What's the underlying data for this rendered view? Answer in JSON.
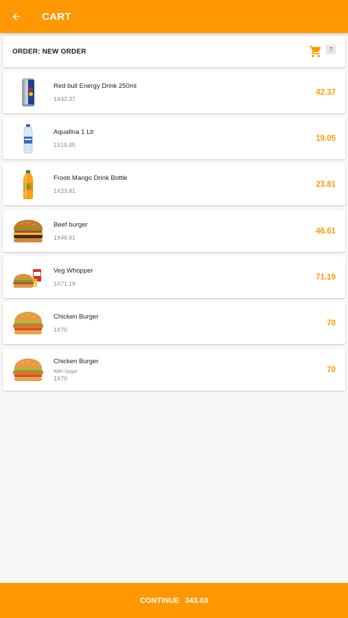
{
  "appbar": {
    "title": "CART",
    "back_icon": "arrow-left-icon"
  },
  "order": {
    "label": "ORDER: NEW ORDER",
    "cart_icon": "cart-icon",
    "item_count": "7"
  },
  "colors": {
    "accent": "#ff9800",
    "background": "#f7f7f7"
  },
  "items": [
    {
      "name": "Red bull Energy Drink 250ml",
      "qty": "1X42.37",
      "price": "42.37",
      "image": "red-bull-can-image"
    },
    {
      "name": "Aquafina 1 Ltr",
      "qty": "1X19.05",
      "price": "19.05",
      "image": "water-bottle-image"
    },
    {
      "name": "Frooti Mango Drink Bottle",
      "qty": "1X23.81",
      "price": "23.81",
      "image": "mango-drink-bottle-image"
    },
    {
      "name": "Beef burger",
      "qty": "1X46.61",
      "price": "46.61",
      "image": "beef-burger-image"
    },
    {
      "name": "Veg Whopper",
      "qty": "1X71.19",
      "price": "71.19",
      "image": "veg-whopper-meal-image"
    },
    {
      "name": "Chicken Burger",
      "qty": "1X70",
      "price": "70",
      "image": "chicken-burger-image"
    },
    {
      "name": "Chicken Burger",
      "note": "With Sugar",
      "qty": "1X70",
      "price": "70",
      "image": "chicken-burger-image"
    }
  ],
  "footer": {
    "continue_label": "CONTINUE",
    "total": "343.03"
  }
}
